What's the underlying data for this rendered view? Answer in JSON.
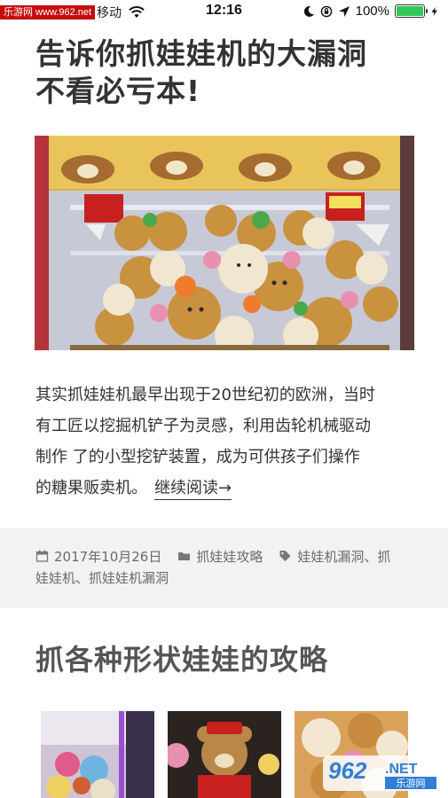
{
  "status_bar": {
    "watermark_badge": "乐游网 www.962.net",
    "carrier": "移动",
    "time": "12:16",
    "battery_percent": "100%",
    "battery_level": 1.0,
    "icons": [
      "wifi-icon",
      "moon-icon",
      "rotation-lock-icon",
      "location-arrow-icon",
      "battery-icon",
      "charging-bolt-icon"
    ]
  },
  "article": {
    "title_lines": [
      "告诉你抓娃娃机的大漏洞",
      "不看必亏本!"
    ],
    "excerpt_lines": [
      "其实抓娃娃机最早出现于20世纪初的欧洲，当时",
      "有工匠以挖掘机铲子为灵感，利用齿轮机械驱动",
      "制作 了的小型挖铲装置，成为可供孩子们操作",
      "的糖果贩卖机。"
    ],
    "read_more": "继续阅读→"
  },
  "meta": {
    "date": "2017年10月26日",
    "category": "抓娃娃攻略",
    "tags_line1": "娃娃机漏洞、抓",
    "tags_line2": "娃娃机、抓娃娃机漏洞"
  },
  "post2": {
    "title": "抓各种形状娃娃的攻略"
  },
  "watermark": {
    "logo_number": "962",
    "logo_suffix": ".NET",
    "logo_cn": "乐游网"
  },
  "colors": {
    "battery_green": "#34c759",
    "badge_red": "#c40d0d",
    "meta_bg": "#f2f2f2",
    "text": "#333333"
  }
}
